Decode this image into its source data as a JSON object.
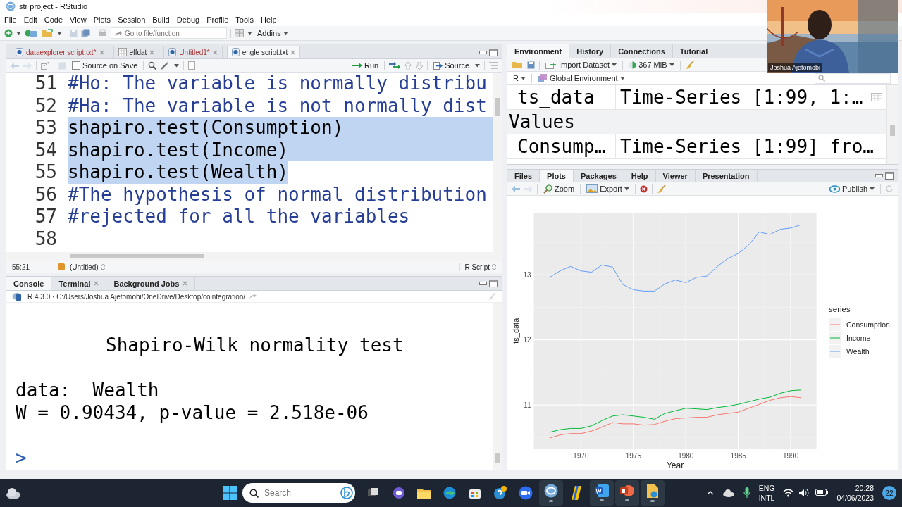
{
  "window": {
    "title": "str project - RStudio"
  },
  "menu": [
    "File",
    "Edit",
    "Code",
    "View",
    "Plots",
    "Session",
    "Build",
    "Debug",
    "Profile",
    "Tools",
    "Help"
  ],
  "toolbar": {
    "search": {
      "placeholder": "Go to file/function"
    },
    "addins": "Addins"
  },
  "editor": {
    "tabs": [
      {
        "label": "dataexplorer script.txt*",
        "kind": "script",
        "modified": true,
        "selected": false
      },
      {
        "label": "effdat",
        "kind": "data",
        "modified": false,
        "selected": false
      },
      {
        "label": "Untitled1*",
        "kind": "script",
        "modified": true,
        "selected": false
      },
      {
        "label": "engle script.txt",
        "kind": "script",
        "modified": false,
        "selected": true
      }
    ],
    "source_on_save": {
      "label": "Source on Save",
      "checked": false
    },
    "run": "Run",
    "source": "Source",
    "lines": [
      {
        "number": "51",
        "text": "#Ho: The variable is normally distribu",
        "kind": "comment",
        "selected": false
      },
      {
        "number": "52",
        "text": "#Ha: The variable is not normally dist",
        "kind": "comment",
        "selected": false
      },
      {
        "number": "53",
        "text": "shapiro.test(Consumption)",
        "kind": "code",
        "selected": true
      },
      {
        "number": "54",
        "text": "shapiro.test(Income)",
        "kind": "code",
        "selected": true
      },
      {
        "number": "55",
        "text": "shapiro.test(Wealth)",
        "kind": "code",
        "selected": true
      },
      {
        "number": "56",
        "text": "#The hypothesis of normal distribution",
        "kind": "comment",
        "selected": false
      },
      {
        "number": "57",
        "text": "#rejected for all the variables",
        "kind": "comment",
        "selected": false
      },
      {
        "number": "58",
        "kind": "code",
        "selected": false
      }
    ],
    "status": {
      "position": "55:21",
      "scope": "(Untitled)",
      "file_type": "R Script"
    }
  },
  "console": {
    "tabs": [
      {
        "label": "Console",
        "selected": true
      },
      {
        "label": "Terminal",
        "selected": false
      },
      {
        "label": "Background Jobs",
        "selected": false
      }
    ],
    "path": "R 4.3.0 · C:/Users/Joshua Ajetomobi/OneDrive/Desktop/cointegration/",
    "lines": [
      {
        "text": "Shapiro-Wilk normality test",
        "kind": "heading"
      },
      {
        "text": "data:  Wealth",
        "kind": "output"
      },
      {
        "text": "W = 0.90434, p-value = 2.518e-06",
        "kind": "output"
      },
      {
        "text": ">",
        "kind": "prompt"
      }
    ]
  },
  "environment": {
    "tabs": [
      {
        "label": "Environment",
        "selected": true
      },
      {
        "label": "History",
        "selected": false
      },
      {
        "label": "Connections",
        "selected": false
      },
      {
        "label": "Tutorial",
        "selected": false
      }
    ],
    "import": "Import Dataset",
    "memory": "367 MiB",
    "language": "R",
    "scope": "Global Environment",
    "rows": [
      {
        "kind": "data",
        "name": "ts_data",
        "value": "Time-Series [1:99, 1:…"
      },
      {
        "kind": "header",
        "name": "Values"
      },
      {
        "kind": "value",
        "name": "Consump…",
        "value": "Time-Series [1:99] fro…"
      }
    ]
  },
  "plots": {
    "tabs": [
      {
        "label": "Files",
        "selected": false
      },
      {
        "label": "Plots",
        "selected": true
      },
      {
        "label": "Packages",
        "selected": false
      },
      {
        "label": "Help",
        "selected": false
      },
      {
        "label": "Viewer",
        "selected": false
      },
      {
        "label": "Presentation",
        "selected": false
      }
    ],
    "zoom": "Zoom",
    "export": "Export",
    "publish": "Publish",
    "legend_title": "series",
    "chart_data": {
      "type": "line",
      "xlabel": "Year",
      "ylabel": "ts_data",
      "x": [
        1967,
        1968,
        1969,
        1970,
        1971,
        1972,
        1973,
        1974,
        1975,
        1976,
        1977,
        1978,
        1979,
        1980,
        1981,
        1982,
        1983,
        1984,
        1985,
        1986,
        1987,
        1988,
        1989,
        1990,
        1991
      ],
      "series": [
        {
          "name": "Consumption",
          "color": "#f8766d",
          "values": [
            10.49,
            10.54,
            10.56,
            10.56,
            10.6,
            10.66,
            10.73,
            10.71,
            10.71,
            10.69,
            10.7,
            10.75,
            10.79,
            10.8,
            10.81,
            10.81,
            10.85,
            10.87,
            10.89,
            10.95,
            11.01,
            11.07,
            11.11,
            11.13,
            11.11
          ]
        },
        {
          "name": "Income",
          "color": "#00ba38",
          "values": [
            10.58,
            10.62,
            10.64,
            10.64,
            10.68,
            10.76,
            10.83,
            10.85,
            10.83,
            10.81,
            10.78,
            10.87,
            10.91,
            10.95,
            10.94,
            10.93,
            10.96,
            10.98,
            11.01,
            11.05,
            11.09,
            11.12,
            11.18,
            11.22,
            11.23
          ]
        },
        {
          "name": "Wealth",
          "color": "#619cff",
          "values": [
            12.96,
            13.06,
            13.13,
            13.06,
            13.04,
            13.15,
            13.12,
            12.85,
            12.77,
            12.75,
            12.75,
            12.86,
            12.92,
            12.88,
            12.96,
            12.98,
            13.13,
            13.25,
            13.33,
            13.46,
            13.66,
            13.62,
            13.7,
            13.72,
            13.77
          ]
        }
      ],
      "xlim": [
        1965.5,
        1992.45
      ],
      "ylim": [
        10.33,
        13.95
      ],
      "xticks": [
        1970,
        1975,
        1980,
        1985,
        1990
      ],
      "yticks": [
        11,
        12,
        13
      ],
      "grid": true,
      "legend": true
    }
  },
  "webcam": {
    "name": "Joshua Ajetomobi"
  },
  "taskbar": {
    "search": {
      "placeholder": "Search"
    },
    "language": "ENG",
    "layout": "INTL",
    "time": "20:28",
    "date": "04/06/2023",
    "notifications": "22",
    "apps": [
      {
        "kind": "taskview",
        "running": false
      },
      {
        "kind": "chat",
        "running": false
      },
      {
        "kind": "folder",
        "running": false
      },
      {
        "kind": "browser",
        "running": false
      },
      {
        "kind": "store",
        "running": false
      },
      {
        "kind": "help",
        "running": false
      },
      {
        "kind": "video",
        "running": false
      },
      {
        "kind": "r",
        "running": true
      },
      {
        "kind": "notes",
        "running": false
      },
      {
        "kind": "word",
        "running": true
      },
      {
        "kind": "slides",
        "running": true
      },
      {
        "kind": "files",
        "running": true
      }
    ]
  }
}
